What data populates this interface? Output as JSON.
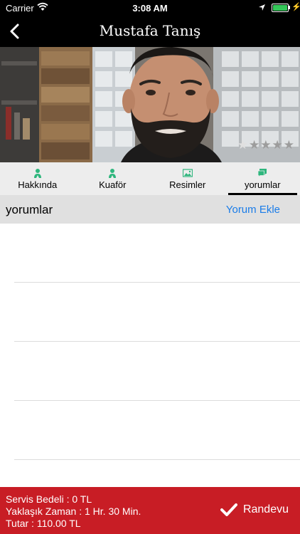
{
  "status_bar": {
    "carrier": "Carrier",
    "time": "3:08 AM"
  },
  "navbar": {
    "title": "Mustafa Tanış"
  },
  "rating": {
    "value": 1,
    "max": 5
  },
  "tabs": [
    {
      "label": "Hakkında",
      "icon": "person-icon"
    },
    {
      "label": "Kuaför",
      "icon": "person-icon"
    },
    {
      "label": "Resimler",
      "icon": "image-icon"
    },
    {
      "label": "yorumlar",
      "icon": "comments-icon",
      "active": true
    }
  ],
  "comments_header": {
    "title": "yorumlar",
    "add_label": "Yorum Ekle"
  },
  "footer": {
    "service_fee": "Servis Bedeli : 0 TL",
    "approx_time": "Yaklaşık Zaman :  1 Hr. 30 Min.",
    "total": "Tutar : 110.00 TL",
    "cta_label": "Randevu"
  },
  "colors": {
    "accent_red": "#c81d25",
    "link_blue": "#1a7ce8",
    "tab_icon_green": "#2eb67d"
  }
}
